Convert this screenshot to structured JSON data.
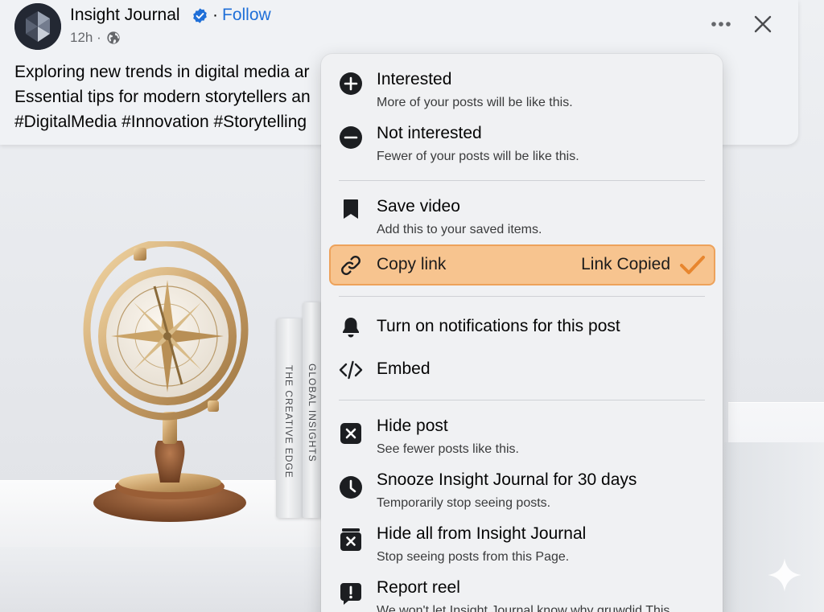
{
  "post": {
    "page_name": "Insight Journal",
    "separator": "·",
    "follow_label": "Follow",
    "time": "12h ·",
    "caption_lines": [
      "Exploring new trends in digital media ar",
      "Essential tips for modern storytellers an",
      "#DigitalMedia #Innovation #Storytelling"
    ]
  },
  "scene": {
    "book_1": "THE CREATIVE EDGE",
    "book_2": "GLOBAL INSIGHTS"
  },
  "menu": {
    "interested": {
      "title": "Interested",
      "subtitle": "More of your posts will be like this."
    },
    "not_interested": {
      "title": "Not interested",
      "subtitle": "Fewer of your posts will be like this."
    },
    "save_video": {
      "title": "Save video",
      "subtitle": "Add this to your saved items."
    },
    "copy_link": {
      "title": "Copy link",
      "status": "Link Copied"
    },
    "notifications": {
      "title": "Turn on notifications for this post"
    },
    "embed": {
      "title": "Embed"
    },
    "hide_post": {
      "title": "Hide post",
      "subtitle": "See fewer posts like this."
    },
    "snooze": {
      "title": "Snooze Insight Journal for 30 days",
      "subtitle": "Temporarily stop seeing posts."
    },
    "hide_all": {
      "title": "Hide all from Insight Journal",
      "subtitle": "Stop seeing posts from this Page."
    },
    "report": {
      "title": "Report reel",
      "subtitle": "We won't let Insight Journal know why gruwdid This"
    }
  },
  "colors": {
    "follow": "#1f6fd8",
    "verified": "#1f6fd8",
    "highlight_fill": "#f7c48f",
    "highlight_border": "#eda25b",
    "check": "#e8862e"
  },
  "icons": {
    "verified": "verified-badge-icon",
    "globe": "globe-icon",
    "more": "more-horizontal-icon",
    "close": "close-icon",
    "interested": "plus-circle-icon",
    "not_interested": "minus-circle-icon",
    "save": "bookmark-icon",
    "copy": "link-icon",
    "copied": "checkmark-icon",
    "notifications": "bell-icon",
    "embed": "code-icon",
    "hide": "x-square-icon",
    "snooze": "clock-icon",
    "hide_all": "archive-x-icon",
    "report": "report-icon",
    "sparkle": "sparkle-icon"
  }
}
